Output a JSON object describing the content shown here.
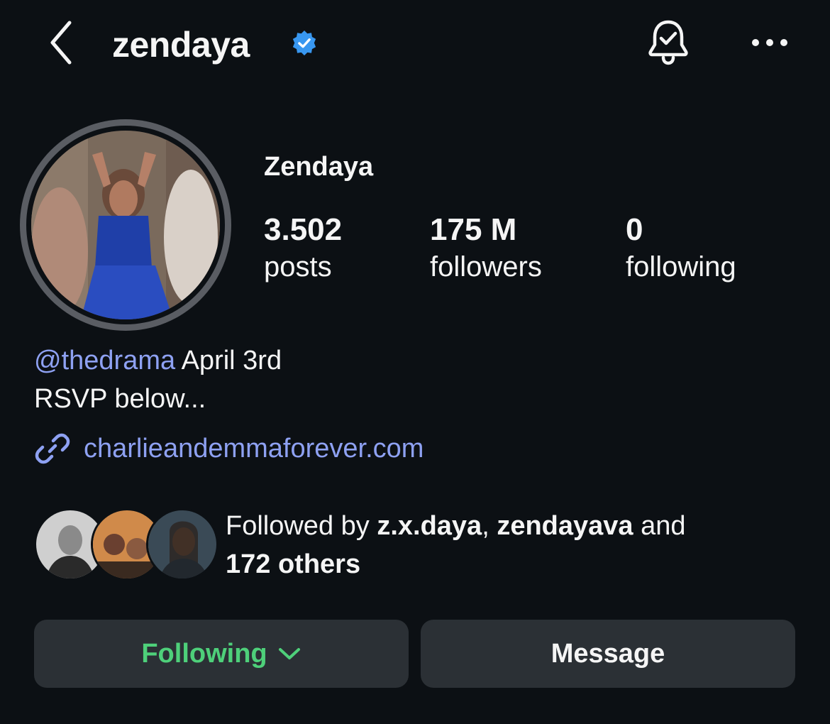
{
  "header": {
    "username": "zendaya",
    "icons": {
      "back": "chevron-left-icon",
      "verified": "verified-badge-icon",
      "notifications": "bell-check-icon",
      "more": "more-horizontal-icon"
    }
  },
  "profile": {
    "display_name": "Zendaya",
    "stats": {
      "posts": {
        "value": "3.502",
        "label": "posts"
      },
      "followers": {
        "value": "175 M",
        "label": "followers"
      },
      "following": {
        "value": "0",
        "label": "following"
      }
    }
  },
  "bio": {
    "mention": "@thedrama",
    "line1_rest": " April 3rd",
    "line2": "RSVP below...",
    "link": "charlieandemmaforever.com",
    "link_icon": "link-icon"
  },
  "followed_by": {
    "prefix": "Followed by ",
    "user1": "z.x.daya",
    "sep": ", ",
    "user2": "zendayava",
    "and": " and",
    "others": "172 others"
  },
  "actions": {
    "following_label": "Following",
    "message_label": "Message"
  },
  "colors": {
    "background": "#0c1014",
    "link": "#8ea1f2",
    "following_green": "#4ed07a",
    "button_bg": "#2b3035",
    "verified_blue": "#3897f0"
  }
}
